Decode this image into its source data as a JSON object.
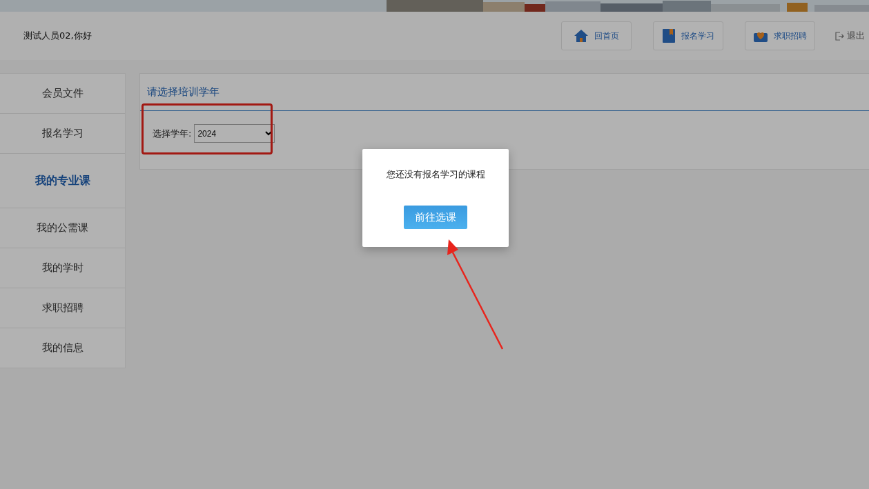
{
  "header": {
    "greeting": "测试人员02,你好",
    "nav": [
      {
        "label": "回首页",
        "kind": "home"
      },
      {
        "label": "报名学习",
        "kind": "book"
      },
      {
        "label": "求职招聘",
        "kind": "mail"
      }
    ],
    "logout": "退出"
  },
  "sidebar": {
    "items": [
      {
        "label": "会员文件",
        "selected": false
      },
      {
        "label": "报名学习",
        "selected": false
      },
      {
        "label": "我的专业课",
        "selected": true
      },
      {
        "label": "我的公需课",
        "selected": false
      },
      {
        "label": "我的学时",
        "selected": false
      },
      {
        "label": "求职招聘",
        "selected": false
      },
      {
        "label": "我的信息",
        "selected": false
      }
    ]
  },
  "panel": {
    "title": "请选择培训学年",
    "select_label": "选择学年:",
    "select_value": "2024"
  },
  "dialog": {
    "message": "您还没有报名学习的课程",
    "button": "前往选课"
  }
}
